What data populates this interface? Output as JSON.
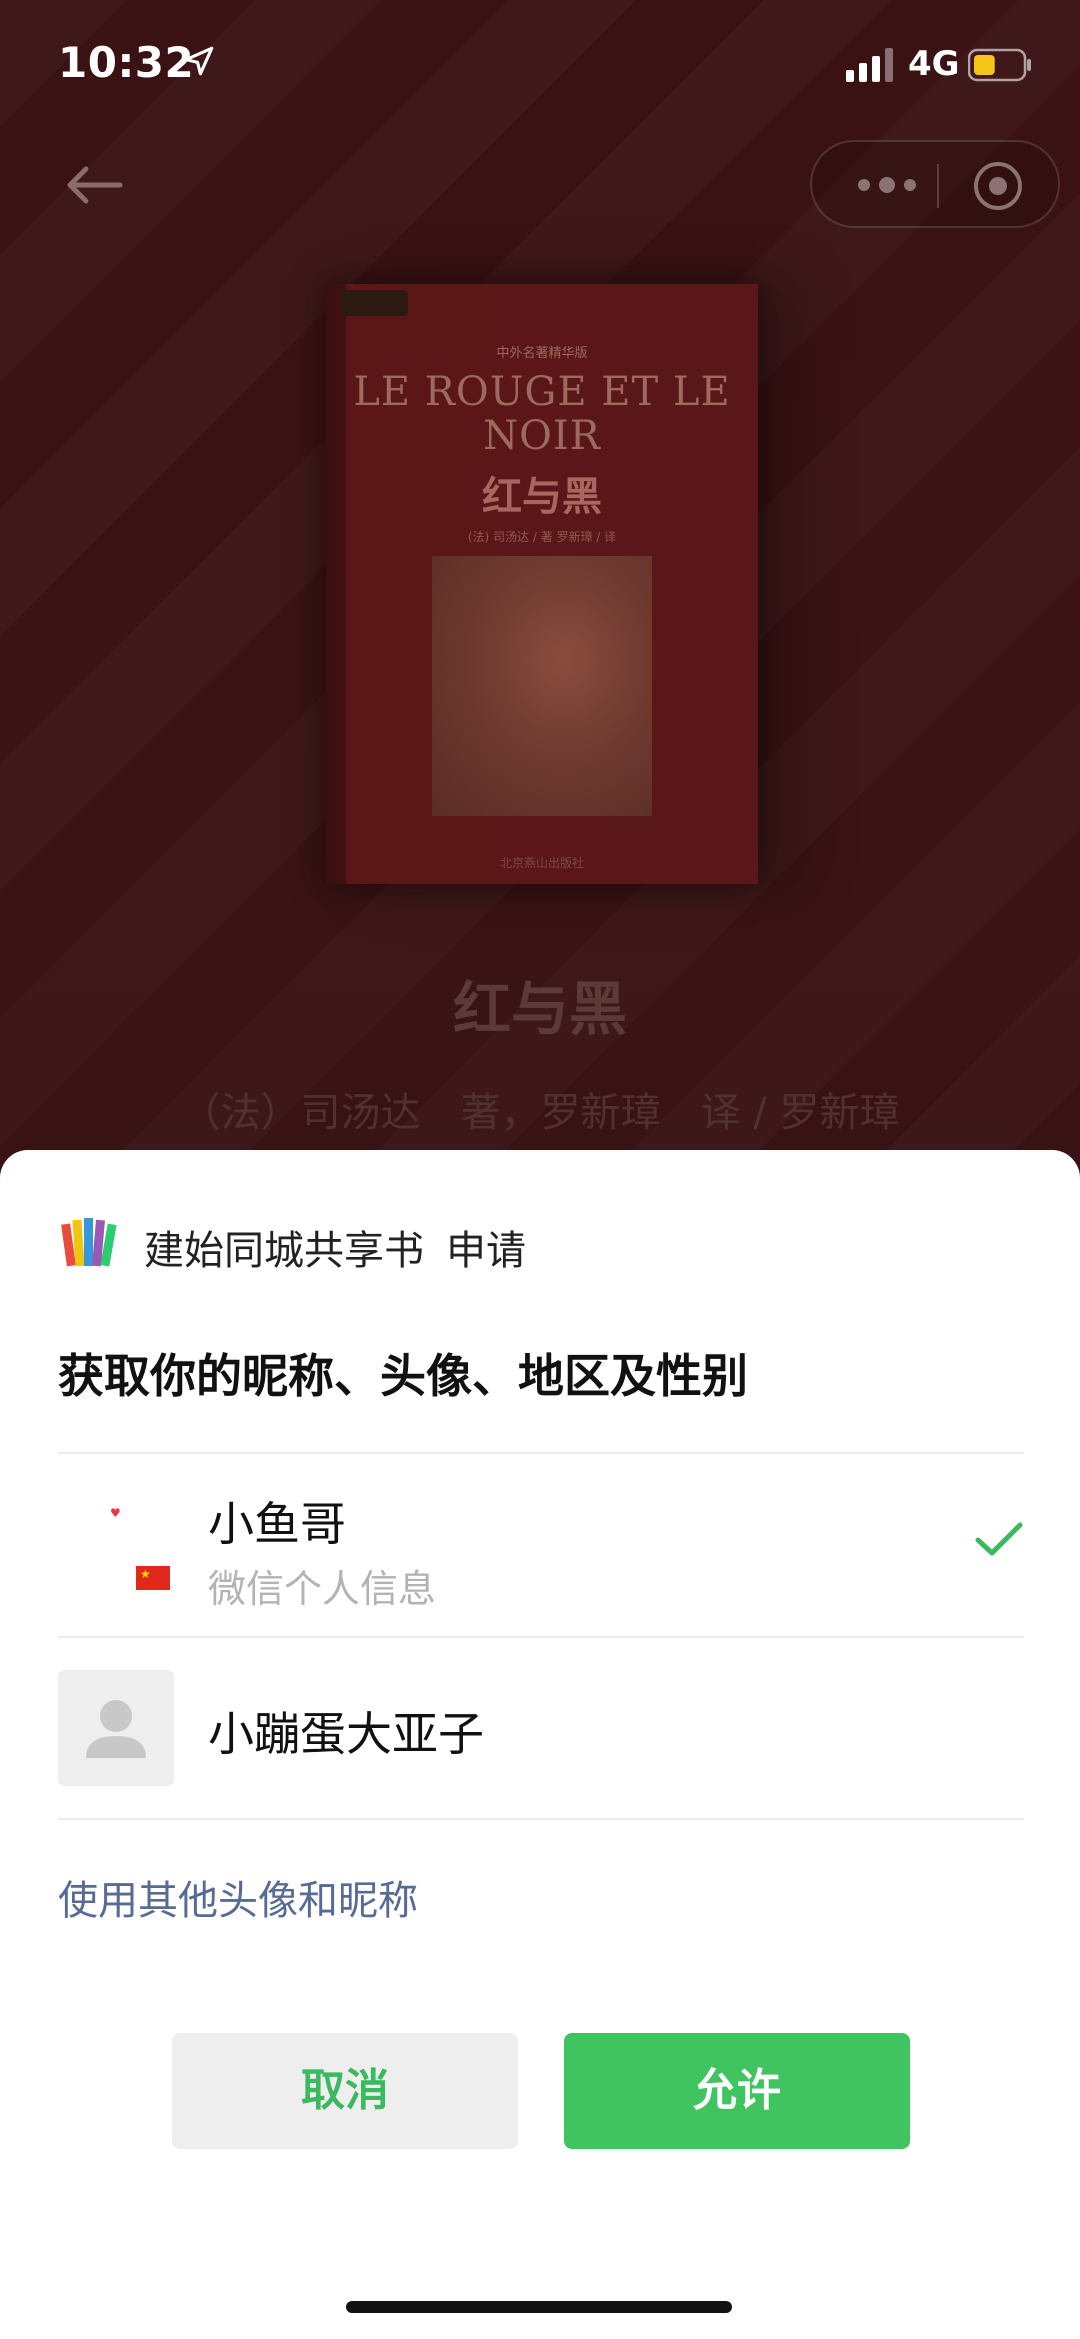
{
  "status_bar": {
    "time": "10:32",
    "network": "4G",
    "battery_level": 0.45,
    "icons": [
      "location-arrow-icon",
      "signal-icon",
      "battery-icon"
    ]
  },
  "nav": {
    "back_icon": "back-arrow-icon",
    "more_icon": "more-dots-icon",
    "close_icon": "target-circle-icon"
  },
  "book": {
    "cover_series": "中外名著精华版",
    "cover_title_fr": "LE ROUGE ET LE NOIR",
    "cover_title_cn": "红与黑",
    "cover_byline": "(法) 司汤达 / 著   罗新璋 / 译",
    "cover_publisher": "北京燕山出版社",
    "title": "红与黑",
    "author_line": "（法）司汤达　著，罗新璋　译 / 罗新璋"
  },
  "sheet": {
    "app_name": "建始同城共享书",
    "apply_label": "申请",
    "request_title": "获取你的昵称、头像、地区及性别",
    "accounts": [
      {
        "name": "小鱼哥",
        "subtitle": "微信个人信息",
        "selected": true
      },
      {
        "name": "小蹦蛋大亚子",
        "subtitle": "",
        "selected": false
      }
    ],
    "other_link": "使用其他头像和昵称",
    "cancel_label": "取消",
    "allow_label": "允许"
  },
  "colors": {
    "accent_green": "#3fc460",
    "link_blue": "#576b95",
    "check_green": "#3cb861",
    "backdrop": "#3a1214"
  }
}
